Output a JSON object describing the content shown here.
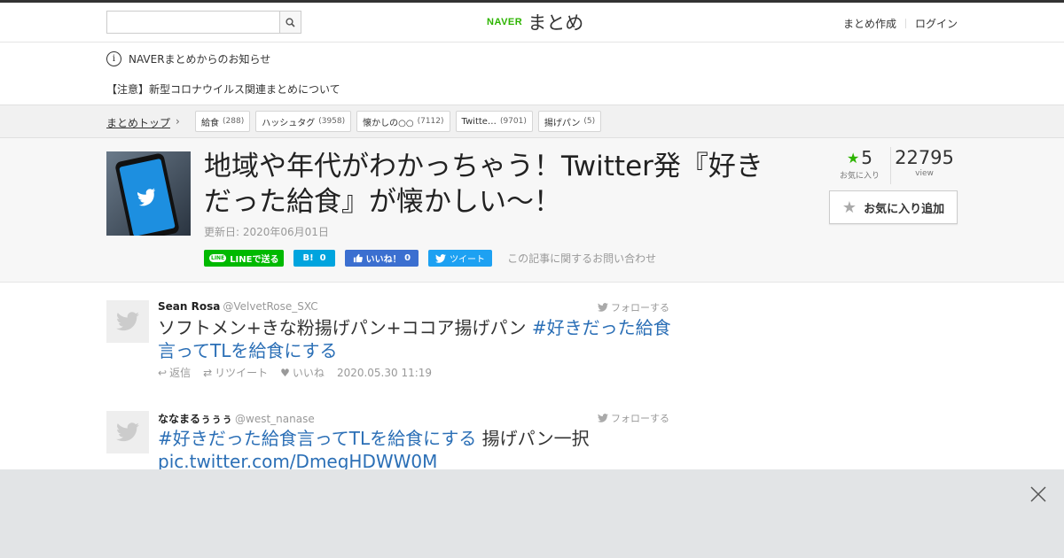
{
  "header": {
    "search_placeholder": "",
    "logo_brand": "NAVER",
    "logo_text": "まとめ",
    "links": [
      "まとめ作成",
      "ログイン"
    ]
  },
  "notices": {
    "title": "NAVERまとめからのお知らせ",
    "item": "【注意】新型コロナウイルス関連まとめについて"
  },
  "breadcrumb": {
    "top": "まとめトップ",
    "tags": [
      {
        "label": "給食",
        "count": "(288)"
      },
      {
        "label": "ハッシュタグ",
        "count": "(3958)"
      },
      {
        "label": "懐かしの○○",
        "count": "(7112)"
      },
      {
        "label": "Twitte…",
        "count": "(9701)"
      },
      {
        "label": "揚げパン",
        "count": "(5)"
      }
    ]
  },
  "article": {
    "title": "地域や年代がわかっちゃう！Twitter発『好きだった給食』が懐かしい～！",
    "updated": "更新日: 2020年06月01日",
    "share": {
      "line": "LINEで送る",
      "line_icon": "LINE",
      "hatena": "B!",
      "hatena_count": "0",
      "fb": "いいね！",
      "fb_count": "0",
      "tweet": "ツイート",
      "contact": "この記事に関するお問い合わせ"
    },
    "stats": {
      "favorites": "5",
      "favorites_label": "お気に入り",
      "views": "22795",
      "views_label": "view"
    },
    "fav_button": "お気に入り追加"
  },
  "tweets": [
    {
      "name": "Sean Rosa",
      "handle": "@VelvetRose_SXC",
      "follow": "フォローする",
      "text_plain": "ソフトメン+きな粉揚げパン+ココア揚げパン ",
      "text_link": "#好きだった給食言ってTLを給食にする",
      "reply": "返信",
      "retweet": "リツイート",
      "like": "いいね",
      "time": "2020.05.30 11:19"
    },
    {
      "name": "ななまるぅぅぅ",
      "handle": "@west_nanase",
      "follow": "フォローする",
      "text_link": "#好きだった給食言ってTLを給食にする",
      "text_plain": " 揚げパン一択",
      "text_link2": "pic.twitter.com/DmegHDWW0M"
    }
  ],
  "colors": {
    "naver_green": "#2db400",
    "link_blue": "#2b6fb6",
    "line_green": "#00b900",
    "twitter_blue": "#1da1f2"
  }
}
